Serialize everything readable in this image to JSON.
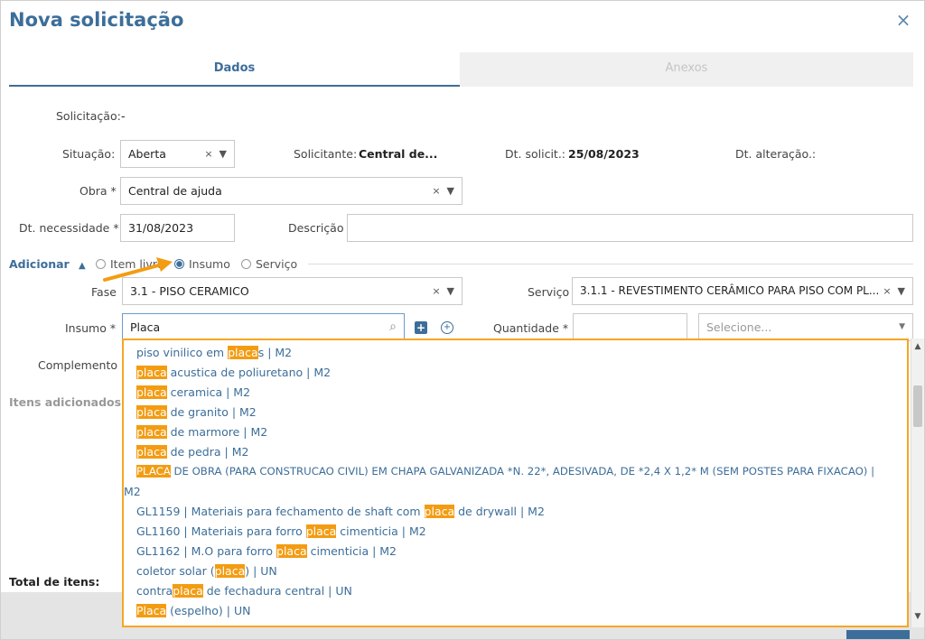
{
  "modal": {
    "title": "Nova solicitação",
    "close_icon": "×"
  },
  "tabs": [
    {
      "label": "Dados"
    },
    {
      "label": "Anexos"
    }
  ],
  "form": {
    "solicitacao": {
      "label": "Solicitação:",
      "value": "-"
    },
    "situacao": {
      "label": "Situação:",
      "value": "Aberta"
    },
    "solicitante": {
      "label": "Solicitante:",
      "value": "Central de..."
    },
    "dt_solicit": {
      "label": "Dt. solicit.:",
      "value": "25/08/2023"
    },
    "dt_alteracao": {
      "label": "Dt. alteração.:"
    },
    "obra": {
      "label": "Obra *",
      "value": "Central de ajuda"
    },
    "dt_necessidade": {
      "label": "Dt. necessidade *",
      "value": "31/08/2023"
    },
    "descricao": {
      "label": "Descrição",
      "value": ""
    }
  },
  "adicionar": {
    "label": "Adicionar",
    "options": [
      {
        "label": "Item livre",
        "selected": false
      },
      {
        "label": "Insumo",
        "selected": true
      },
      {
        "label": "Serviço",
        "selected": false
      }
    ],
    "fase": {
      "label": "Fase",
      "value": "3.1 - PISO CERAMICO"
    },
    "servico": {
      "label": "Serviço",
      "value": "3.1.1 - REVESTIMENTO CERÂMICO PARA PISO COM PL..."
    },
    "insumo": {
      "label": "Insumo *",
      "value": "Placa"
    },
    "quantidade": {
      "label": "Quantidade *",
      "value": ""
    },
    "unidade": {
      "placeholder": "Selecione..."
    },
    "complemento": {
      "label": "Complemento"
    }
  },
  "itens_adicionados": {
    "label": "Itens adicionados"
  },
  "total": {
    "label": "Total de itens:"
  },
  "suggestions": [
    {
      "before": "piso vinilico em ",
      "match": "placa",
      "after": "s | M2"
    },
    {
      "before": "",
      "match": "placa",
      "after": " acustica de poliuretano | M2"
    },
    {
      "before": "",
      "match": "placa",
      "after": " ceramica | M2"
    },
    {
      "before": "",
      "match": "placa",
      "after": " de granito | M2"
    },
    {
      "before": "",
      "match": "placa",
      "after": " de marmore | M2"
    },
    {
      "before": "",
      "match": "placa",
      "after": " de pedra | M2"
    },
    {
      "before": "",
      "match": "PLACA",
      "after": " DE OBRA (PARA CONSTRUCAO CIVIL) EM CHAPA GALVANIZADA *N. 22*, ADESIVADA, DE *2,4 X 1,2* M (SEM POSTES PARA FIXACAO) |"
    },
    {
      "before": "M2",
      "match": "",
      "after": ""
    },
    {
      "before": "GL1159 | Materiais para fechamento de shaft com ",
      "match": "placa",
      "after": " de drywall | M2"
    },
    {
      "before": "GL1160 | Materiais para forro ",
      "match": "placa",
      "after": " cimenticia | M2"
    },
    {
      "before": "GL1162 | M.O para forro ",
      "match": "placa",
      "after": " cimenticia | M2"
    },
    {
      "before": "coletor solar (",
      "match": "placa",
      "after": ") | UN"
    },
    {
      "before": "contra",
      "match": "placa",
      "after": " de fechadura central | UN"
    },
    {
      "before": "",
      "match": "Placa",
      "after": " (espelho) | UN"
    }
  ]
}
